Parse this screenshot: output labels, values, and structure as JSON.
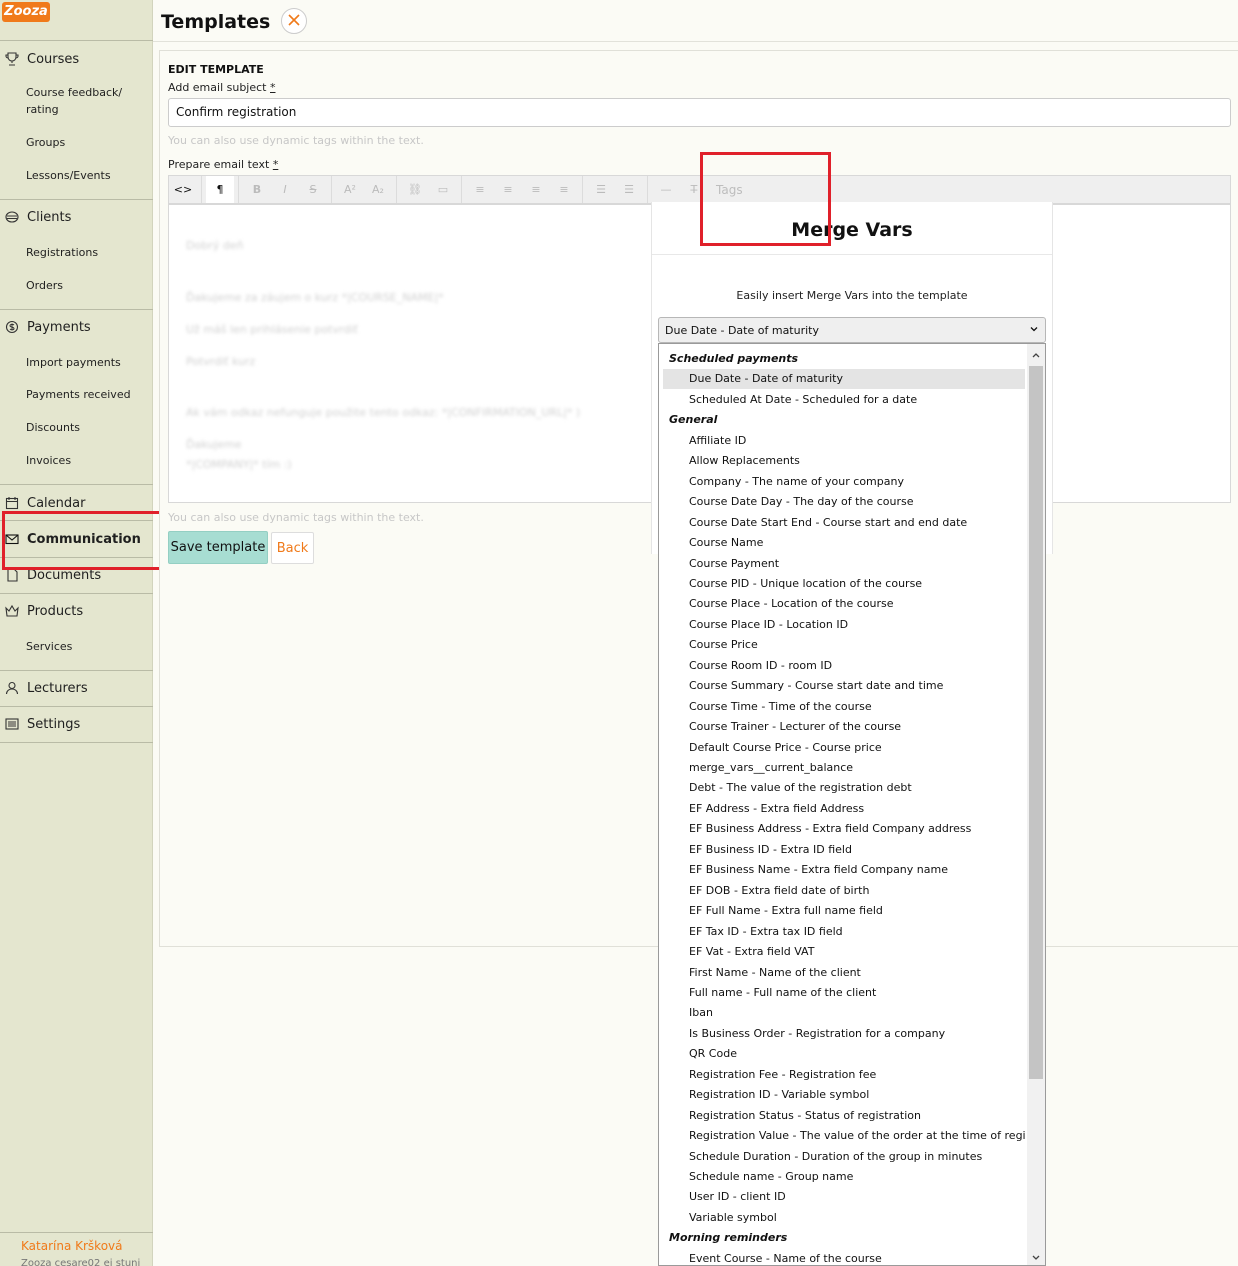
{
  "app": {
    "logo_text": "Zooza",
    "page_title": "Templates"
  },
  "sidebar": {
    "courses": "Courses",
    "course_feedback": "Course feedback/ rating",
    "groups": "Groups",
    "lessons_events": "Lessons/Events",
    "clients": "Clients",
    "registrations": "Registrations",
    "orders": "Orders",
    "payments": "Payments",
    "import_payments": "Import payments",
    "payments_received": "Payments received",
    "discounts": "Discounts",
    "invoices": "Invoices",
    "calendar": "Calendar",
    "communication": "Communication",
    "documents": "Documents",
    "products": "Products",
    "services": "Services",
    "lecturers": "Lecturers",
    "settings": "Settings",
    "user_name": "Katarína Kršková",
    "user_sub": "Zooza cesare02 ej stuni"
  },
  "form": {
    "section_title": "EDIT TEMPLATE",
    "subject_label": "Add email subject",
    "required_mark": "*",
    "subject_value": "Confirm registration",
    "subject_hint": "You can also use dynamic tags within the text.",
    "text_label": "Prepare email text",
    "text_hint": "You can also use dynamic tags within the text.",
    "save_label": "Save template",
    "back_label": "Back"
  },
  "toolbar": {
    "tags_label": "Tags"
  },
  "editor_blurred": [
    "Dobrý deň",
    "Ďakujeme za záujem o kurz *|COURSE_NAME|*",
    "Už máš len prihlásenie potvrdiť",
    "Potvrdiť kurz",
    "Ak vám odkaz nefunguje použite tento odkaz: *|CONFIRMATION_URL|* )",
    "Ďakujeme",
    "*|COMPANY|* tím :)"
  ],
  "merge_vars": {
    "title": "Merge Vars",
    "description": "Easily insert Merge Vars into the template",
    "selected": "Due Date - Date of maturity",
    "options": [
      {
        "type": "group",
        "label": "Scheduled payments"
      },
      {
        "type": "opt",
        "label": "Due Date - Date of maturity",
        "selected": true
      },
      {
        "type": "opt",
        "label": "Scheduled At Date - Scheduled for a date"
      },
      {
        "type": "group",
        "label": "General"
      },
      {
        "type": "opt",
        "label": "Affiliate ID"
      },
      {
        "type": "opt",
        "label": "Allow Replacements"
      },
      {
        "type": "opt",
        "label": "Company - The name of your company"
      },
      {
        "type": "opt",
        "label": "Course Date Day - The day of the course"
      },
      {
        "type": "opt",
        "label": "Course Date Start End - Course start and end date"
      },
      {
        "type": "opt",
        "label": "Course Name"
      },
      {
        "type": "opt",
        "label": "Course Payment"
      },
      {
        "type": "opt",
        "label": "Course PID - Unique location of the course"
      },
      {
        "type": "opt",
        "label": "Course Place - Location of the course"
      },
      {
        "type": "opt",
        "label": "Course Place ID - Location ID"
      },
      {
        "type": "opt",
        "label": "Course Price"
      },
      {
        "type": "opt",
        "label": "Course Room ID - room ID"
      },
      {
        "type": "opt",
        "label": "Course Summary - Course start date and time"
      },
      {
        "type": "opt",
        "label": "Course Time - Time of the course"
      },
      {
        "type": "opt",
        "label": "Course Trainer - Lecturer of the course"
      },
      {
        "type": "opt",
        "label": "Default Course Price - Course price"
      },
      {
        "type": "opt",
        "label": "merge_vars__current_balance"
      },
      {
        "type": "opt",
        "label": "Debt - The value of the registration debt"
      },
      {
        "type": "opt",
        "label": "EF Address - Extra field Address"
      },
      {
        "type": "opt",
        "label": "EF Business Address - Extra field Company address"
      },
      {
        "type": "opt",
        "label": "EF Business ID - Extra ID field"
      },
      {
        "type": "opt",
        "label": "EF Business Name - Extra field Company name"
      },
      {
        "type": "opt",
        "label": "EF DOB - Extra field date of birth"
      },
      {
        "type": "opt",
        "label": "EF Full Name - Extra full name field"
      },
      {
        "type": "opt",
        "label": "EF Tax ID - Extra tax ID field"
      },
      {
        "type": "opt",
        "label": "EF Vat - Extra field VAT"
      },
      {
        "type": "opt",
        "label": "First Name - Name of the client"
      },
      {
        "type": "opt",
        "label": "Full name - Full name of the client"
      },
      {
        "type": "opt",
        "label": "Iban"
      },
      {
        "type": "opt",
        "label": "Is Business Order - Registration for a company"
      },
      {
        "type": "opt",
        "label": "QR Code"
      },
      {
        "type": "opt",
        "label": "Registration Fee - Registration fee"
      },
      {
        "type": "opt",
        "label": "Registration ID - Variable symbol"
      },
      {
        "type": "opt",
        "label": "Registration Status - Status of registration"
      },
      {
        "type": "opt",
        "label": "Registration Value - The value of the order at the time of registration"
      },
      {
        "type": "opt",
        "label": "Schedule Duration - Duration of the group in minutes"
      },
      {
        "type": "opt",
        "label": "Schedule name - Group name"
      },
      {
        "type": "opt",
        "label": "User ID - client ID"
      },
      {
        "type": "opt",
        "label": "Variable symbol"
      },
      {
        "type": "group",
        "label": "Morning reminders"
      },
      {
        "type": "opt",
        "label": "Event Course - Name of the course"
      }
    ]
  },
  "colors": {
    "accent_orange": "#f07a1a",
    "highlight_red": "#e0202a",
    "save_teal": "#a7ddd2",
    "sidebar_bg": "#e4e6cf"
  }
}
